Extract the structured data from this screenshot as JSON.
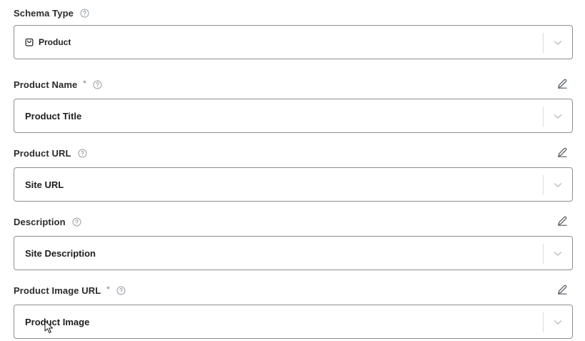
{
  "fields": [
    {
      "label": "Schema Type",
      "required": false,
      "help_icon": "help-circle-icon",
      "value": "Product",
      "value_icon": "shopping-bag-icon",
      "editable": false
    },
    {
      "label": "Product Name",
      "required": true,
      "help_icon": "help-circle-icon",
      "value": "Product Title",
      "editable": true
    },
    {
      "label": "Product URL",
      "required": false,
      "help_icon": "help-circle-icon",
      "value": "Site URL",
      "editable": true
    },
    {
      "label": "Description",
      "required": false,
      "help_icon": "help-circle-icon",
      "value": "Site Description",
      "editable": true
    },
    {
      "label": "Product Image URL",
      "required": true,
      "help_icon": "help-circle-icon",
      "value": "Product Image",
      "editable": true
    }
  ],
  "required_marker": "*",
  "icons": {
    "edit": "pencil-icon",
    "dropdown": "chevron-down-icon",
    "cursor": "mouse-pointer-icon"
  },
  "colors": {
    "border": "#8c8f94",
    "divider": "#dcdcde",
    "icon": "#9aa0a6",
    "text": "#1e1e1e"
  }
}
